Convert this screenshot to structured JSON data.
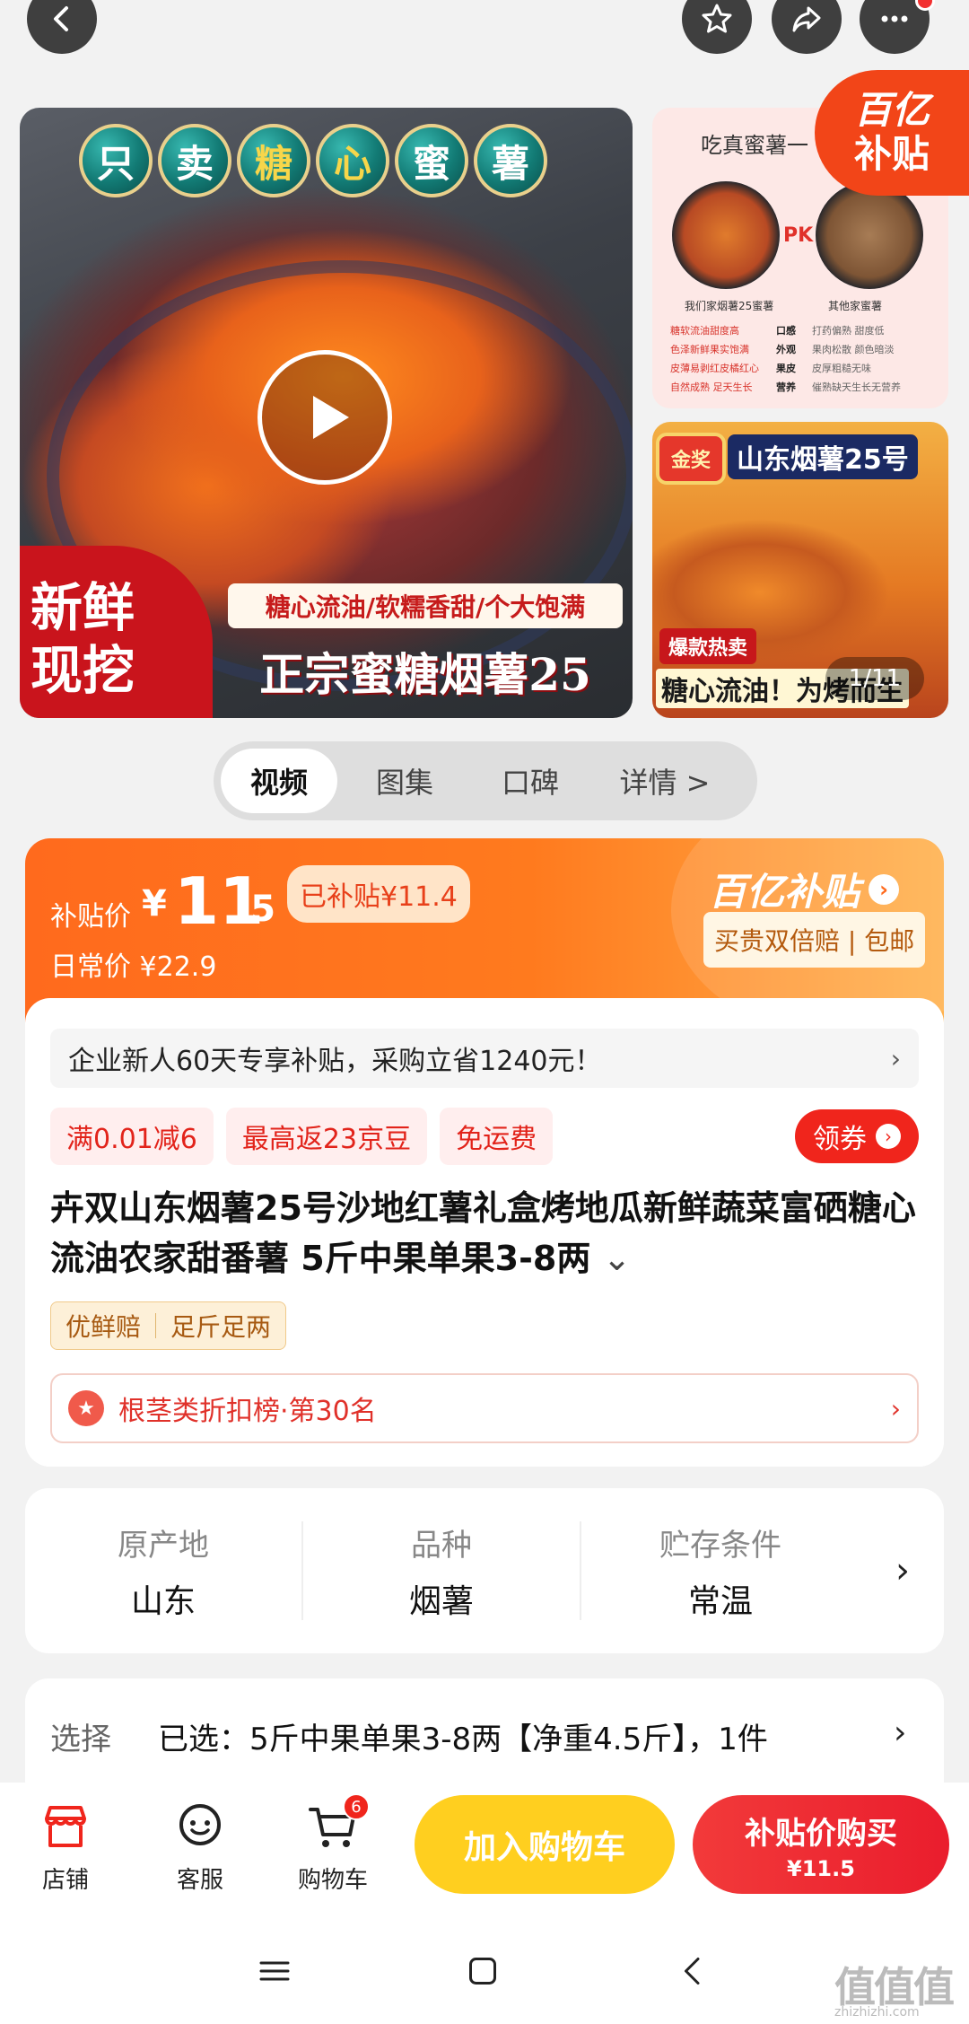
{
  "topbar": {
    "back_icon": "back-arrow-icon",
    "fav_icon": "star-icon",
    "share_icon": "share-icon",
    "more_icon": "more-dots-icon"
  },
  "gallery": {
    "main_title_chars": [
      "只",
      "卖",
      "糖",
      "心",
      "蜜",
      "薯"
    ],
    "fresh_badge_line1": "新鲜",
    "fresh_badge_line2": "现挖",
    "sub_banner": "糖心流油/软糯香甜/个大饱满",
    "main_banner": "正宗蜜糖烟薯25",
    "thumb1": {
      "header": "吃真蜜薯一",
      "pk": "PK",
      "left_caption": "我们家烟薯25蜜薯",
      "right_caption": "其他家蜜薯",
      "rows": [
        {
          "ours": "糖软流油甜度高",
          "attr": "口感",
          "theirs": "打药偏熟 甜度低"
        },
        {
          "ours": "色泽新鲜果实饱满",
          "attr": "外观",
          "theirs": "果肉松散 颜色暗淡"
        },
        {
          "ours": "皮薄易剥红皮橘红心",
          "attr": "果皮",
          "theirs": "皮厚粗糙无味"
        },
        {
          "ours": "自然成熟 足天生长",
          "attr": "营养",
          "theirs": "催熟缺天生长无营养"
        }
      ]
    },
    "subsidy_tag_line1": "百亿",
    "subsidy_tag_line2": "补贴",
    "thumb2": {
      "medal": "金奖",
      "title": "山东烟薯25号",
      "hot": "爆款热卖",
      "bottom": "糖心流油！为烤而生"
    },
    "page_indicator": "1/11"
  },
  "tabs": [
    "视频",
    "图集",
    "口碑",
    "详情 >"
  ],
  "price": {
    "label": "补贴价",
    "yen": "¥",
    "integer": "11",
    "decimal": ".5",
    "saved": "已补贴¥11.4",
    "daily": "日常价 ¥22.9",
    "brand": "百亿补贴",
    "brand_arrow": "›",
    "promise": "买贵双倍赔 | 包邮"
  },
  "notice": {
    "text": "企业新人60天专享补贴，采购立省1240元！",
    "chev": "›"
  },
  "coupons": [
    "满0.01减6",
    "最高返23京豆",
    "免运费"
  ],
  "get_coupon": "领券",
  "product": {
    "title": "卉双山东烟薯25号沙地红薯礼盒烤地瓜新鲜蔬菜富硒糖心流油农家甜番薯 5斤中果单果3-8两",
    "expand": "⌄",
    "guarantees": [
      "优鲜赔",
      "足斤足两"
    ],
    "rank": "根茎类折扣榜·第30名",
    "rank_chev": "›"
  },
  "attributes": [
    {
      "key": "原产地",
      "value": "山东"
    },
    {
      "key": "品种",
      "value": "烟薯"
    },
    {
      "key": "贮存条件",
      "value": "常温"
    }
  ],
  "attributes_chev": "›",
  "selection": {
    "label": "选择",
    "value": "已选：5斤中果单果3-8两【净重4.5斤】，1件",
    "chev": "›"
  },
  "actionbar": {
    "store": "店铺",
    "service": "客服",
    "cart": "购物车",
    "cart_count": "6",
    "add_to_cart": "加入购物车",
    "buy_label": "补贴价购买",
    "buy_price": "¥11.5"
  },
  "sysnav": {
    "watermark": "值值值",
    "watermark_sub": "zhizhizhi.com"
  },
  "colors": {
    "accent_orange": "#ff6a1d",
    "accent_red": "#f0251c",
    "cart_yellow": "#ffcf1f"
  }
}
